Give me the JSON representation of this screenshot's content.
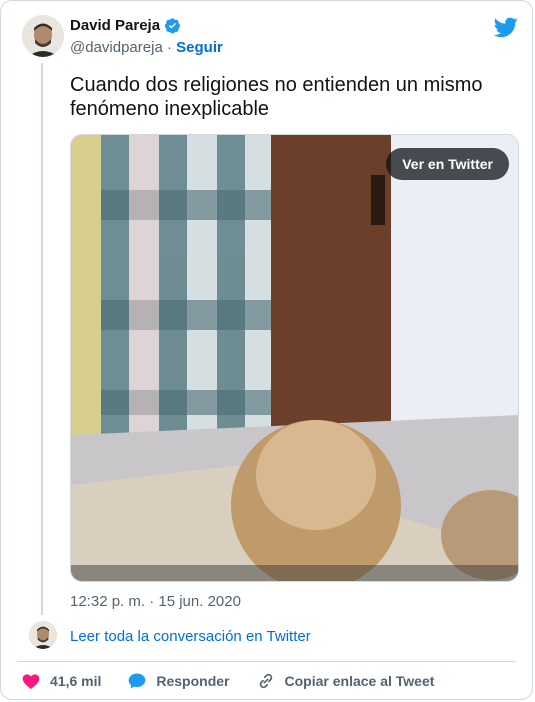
{
  "author": {
    "name": "David Pareja",
    "handle": "@davidpareja",
    "separator": "·",
    "follow_label": "Seguir"
  },
  "tweet": {
    "text": "Cuando dos religiones no entienden un mismo fenómeno inexplicable",
    "media_button_label": "Ver en Twitter",
    "timestamp": "12:32 p. m. · 15 jun. 2020"
  },
  "thread": {
    "read_more_label": "Leer toda la conversación en Twitter"
  },
  "actions": {
    "like_count": "41,6 mil",
    "reply_label": "Responder",
    "copy_link_label": "Copiar enlace al Tweet"
  },
  "icons": {
    "like": "heart-icon",
    "reply": "speech-bubble-icon",
    "copy": "link-icon",
    "brand": "twitter-bird-icon",
    "verified": "verified-badge-icon"
  },
  "colors": {
    "link": "#006fd6",
    "twitter_blue": "#1d9bf0",
    "like": "#f91880",
    "muted": "#536471"
  }
}
